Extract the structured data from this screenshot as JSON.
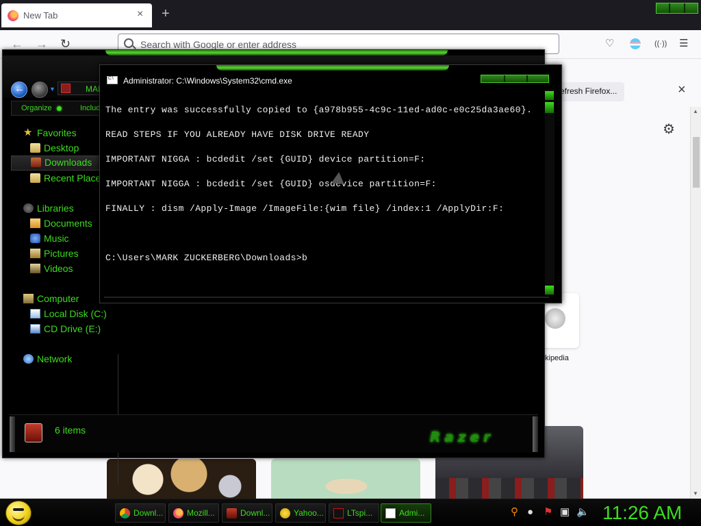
{
  "browser": {
    "tab_title": "New Tab",
    "tab_close": "×",
    "new_tab": "+",
    "url_placeholder": "Search with Google or enter address",
    "notice_text": "efresh Firefox...",
    "notice_close": "×",
    "site_label": "kipedia"
  },
  "explorer": {
    "path_label": "MAF",
    "organize_label": "Organize",
    "include_label": "Includ",
    "favorites": [
      "Favorites",
      "Desktop",
      "Downloads",
      "Recent Places"
    ],
    "libraries": [
      "Libraries",
      "Documents",
      "Music",
      "Pictures",
      "Videos"
    ],
    "computer": [
      "Computer",
      "Local Disk (C:)",
      "CD Drive (E:)"
    ],
    "network": "Network",
    "selected_item": "Downloads",
    "item_count": "6 items",
    "brand_logo": "Razer"
  },
  "cmd": {
    "title": "Administrator: C:\\Windows\\System32\\cmd.exe",
    "lines": [
      "The entry was successfully copied to {a978b955-4c9c-11ed-ad0c-e0c25da3ae60}.",
      "READ STEPS IF YOU ALREADY HAVE DISK DRIVE READY",
      "IMPORTANT NIGGA : bcdedit /set {GUID} device partition=F:",
      "IMPORTANT NIGGA : bcdedit /set {GUID} osdevice partition=F:",
      "FINALLY : dism /Apply-Image /ImageFile:{wim file} /index:1 /ApplyDir:F:",
      "",
      "C:\\Users\\MARK ZUCKERBERG\\Downloads>b"
    ]
  },
  "taskbar": {
    "buttons": [
      {
        "label": "Downl...",
        "icon": "chrome-icon"
      },
      {
        "label": "Mozill...",
        "icon": "firefox-icon"
      },
      {
        "label": "Downl...",
        "icon": "folder-icon"
      },
      {
        "label": "Yahoo...",
        "icon": "yahoo-icon"
      },
      {
        "label": "LTspi...",
        "icon": "ltspice-icon"
      },
      {
        "label": "Admi...",
        "icon": "cmd-icon"
      }
    ],
    "clock": "11:26 AM"
  },
  "colors": {
    "accent_green": "#3ddc1f",
    "background": "#000000"
  }
}
